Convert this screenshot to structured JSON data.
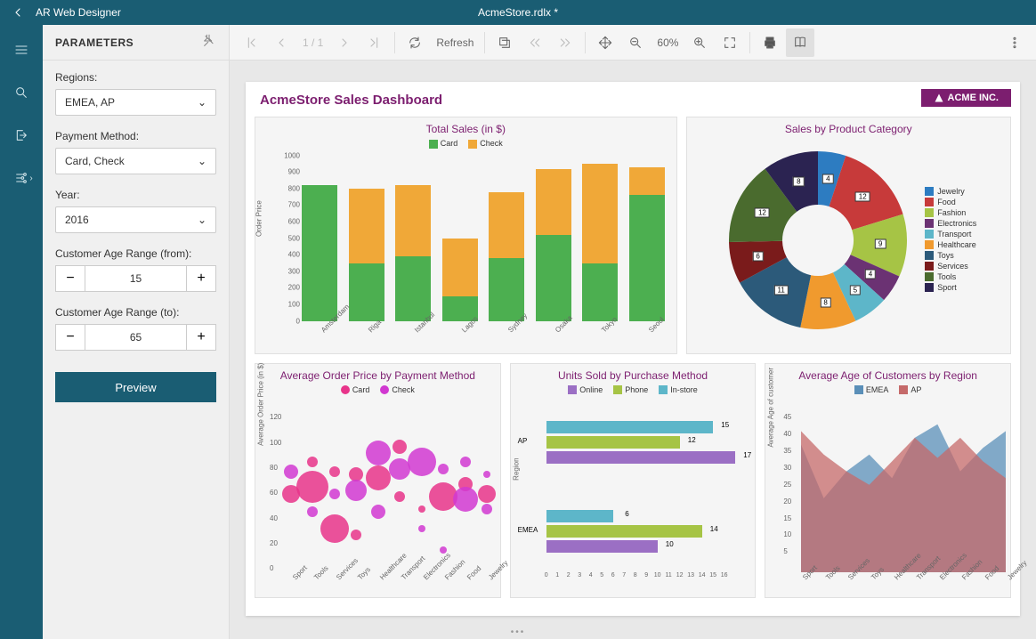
{
  "app": {
    "name": "AR Web Designer",
    "document": "AcmeStore.rdlx *"
  },
  "params": {
    "header": "PARAMETERS",
    "regions_label": "Regions:",
    "regions_value": "EMEA, AP",
    "payment_label": "Payment Method:",
    "payment_value": "Card, Check",
    "year_label": "Year:",
    "year_value": "2016",
    "age_from_label": "Customer Age Range (from):",
    "age_from_value": "15",
    "age_to_label": "Customer Age Range (to):",
    "age_to_value": "65",
    "preview": "Preview"
  },
  "toolbar": {
    "page_info": "1 / 1",
    "refresh": "Refresh",
    "zoom": "60%"
  },
  "dashboard": {
    "title": "AcmeStore Sales Dashboard",
    "logo": "ACME INC."
  },
  "chart_data": [
    {
      "id": "total_sales",
      "type": "bar",
      "title": "Total Sales (in $)",
      "ylabel": "Order Price",
      "ylim": [
        0,
        1000
      ],
      "yticks": [
        0,
        100,
        200,
        300,
        400,
        500,
        600,
        700,
        800,
        900,
        1000
      ],
      "categories": [
        "Amsterdam",
        "Riga",
        "Istanbul",
        "Lagos",
        "Sydney",
        "Osaka",
        "Tokyo",
        "Seoul"
      ],
      "series": [
        {
          "name": "Card",
          "color": "#4caf50",
          "values": [
            820,
            350,
            390,
            150,
            380,
            520,
            350,
            760
          ]
        },
        {
          "name": "Check",
          "color": "#f0a838",
          "values": [
            0,
            450,
            430,
            350,
            400,
            400,
            600,
            170
          ]
        }
      ]
    },
    {
      "id": "category_pie",
      "type": "pie",
      "title": "Sales by Product Category",
      "series": [
        {
          "name": "Jewelry",
          "color": "#2d7cc1",
          "value": 4
        },
        {
          "name": "Food",
          "color": "#c73a3a",
          "value": 12
        },
        {
          "name": "Fashion",
          "color": "#a6c445",
          "value": 9
        },
        {
          "name": "Electronics",
          "color": "#6b3273",
          "value": 4
        },
        {
          "name": "Transport",
          "color": "#5db6c9",
          "value": 5
        },
        {
          "name": "Healthcare",
          "color": "#f09a2e",
          "value": 8
        },
        {
          "name": "Toys",
          "color": "#2c5a7a",
          "value": 11
        },
        {
          "name": "Services",
          "color": "#7a1b1b",
          "value": 6
        },
        {
          "name": "Tools",
          "color": "#4a6b2e",
          "value": 12
        },
        {
          "name": "Sport",
          "color": "#2b2351",
          "value": 8
        }
      ]
    },
    {
      "id": "avg_order",
      "type": "scatter",
      "title": "Average Order Price by Payment Method",
      "ylabel": "Average Order Price (in $)",
      "ylim": [
        0,
        120
      ],
      "yticks": [
        0,
        20,
        40,
        60,
        80,
        100,
        120
      ],
      "categories": [
        "Sport",
        "Tools",
        "Services",
        "Toys",
        "Healthcare",
        "Transport",
        "Electronics",
        "Fashion",
        "Food",
        "Jewelry"
      ],
      "series": [
        {
          "name": "Card",
          "color": "#e8348a",
          "points": [
            {
              "x": 0,
              "y": 62,
              "r": 10
            },
            {
              "x": 1,
              "y": 68,
              "r": 18
            },
            {
              "x": 1,
              "y": 88,
              "r": 6
            },
            {
              "x": 2,
              "y": 80,
              "r": 6
            },
            {
              "x": 2,
              "y": 35,
              "r": 16
            },
            {
              "x": 3,
              "y": 30,
              "r": 6
            },
            {
              "x": 3,
              "y": 78,
              "r": 8
            },
            {
              "x": 4,
              "y": 75,
              "r": 14
            },
            {
              "x": 5,
              "y": 60,
              "r": 6
            },
            {
              "x": 5,
              "y": 100,
              "r": 8
            },
            {
              "x": 6,
              "y": 50,
              "r": 4
            },
            {
              "x": 7,
              "y": 60,
              "r": 16
            },
            {
              "x": 8,
              "y": 70,
              "r": 8
            },
            {
              "x": 9,
              "y": 62,
              "r": 10
            }
          ]
        },
        {
          "name": "Check",
          "color": "#d138d1",
          "points": [
            {
              "x": 0,
              "y": 80,
              "r": 8
            },
            {
              "x": 1,
              "y": 48,
              "r": 6
            },
            {
              "x": 2,
              "y": 62,
              "r": 6
            },
            {
              "x": 3,
              "y": 65,
              "r": 12
            },
            {
              "x": 4,
              "y": 95,
              "r": 14
            },
            {
              "x": 4,
              "y": 48,
              "r": 8
            },
            {
              "x": 5,
              "y": 82,
              "r": 12
            },
            {
              "x": 6,
              "y": 88,
              "r": 16
            },
            {
              "x": 6,
              "y": 35,
              "r": 4
            },
            {
              "x": 7,
              "y": 18,
              "r": 4
            },
            {
              "x": 7,
              "y": 82,
              "r": 6
            },
            {
              "x": 8,
              "y": 58,
              "r": 14
            },
            {
              "x": 8,
              "y": 88,
              "r": 6
            },
            {
              "x": 9,
              "y": 50,
              "r": 6
            },
            {
              "x": 9,
              "y": 78,
              "r": 4
            }
          ]
        }
      ]
    },
    {
      "id": "units_sold",
      "type": "bar",
      "orientation": "horizontal",
      "title": "Units Sold by Purchase Method",
      "xlabel": "Region",
      "xlim": [
        0,
        16
      ],
      "xticks": [
        0,
        1,
        2,
        3,
        4,
        5,
        6,
        7,
        8,
        9,
        10,
        11,
        12,
        13,
        14,
        15,
        16
      ],
      "categories": [
        "AP",
        "EMEA"
      ],
      "series": [
        {
          "name": "Online",
          "color": "#9b6fc4",
          "values": [
            17,
            10
          ]
        },
        {
          "name": "Phone",
          "color": "#a6c445",
          "values": [
            12,
            14
          ]
        },
        {
          "name": "In-store",
          "color": "#5db6c9",
          "values": [
            15,
            6
          ]
        }
      ]
    },
    {
      "id": "avg_age",
      "type": "area",
      "title": "Average Age of Customers by Region",
      "ylabel": "Average Age of customer",
      "ylim": [
        0,
        45
      ],
      "yticks": [
        5,
        10,
        15,
        20,
        25,
        30,
        35,
        40,
        45
      ],
      "categories": [
        "Sport",
        "Tools",
        "Services",
        "Toys",
        "Healthcare",
        "Transport",
        "Electronics",
        "Fashion",
        "Food",
        "Jewelry"
      ],
      "series": [
        {
          "name": "EMEA",
          "color": "#5a8fb8",
          "values": [
            38,
            22,
            30,
            35,
            28,
            40,
            44,
            30,
            37,
            42
          ]
        },
        {
          "name": "AP",
          "color": "#c56a6a",
          "values": [
            42,
            35,
            30,
            26,
            33,
            40,
            34,
            40,
            33,
            28
          ]
        }
      ]
    }
  ]
}
